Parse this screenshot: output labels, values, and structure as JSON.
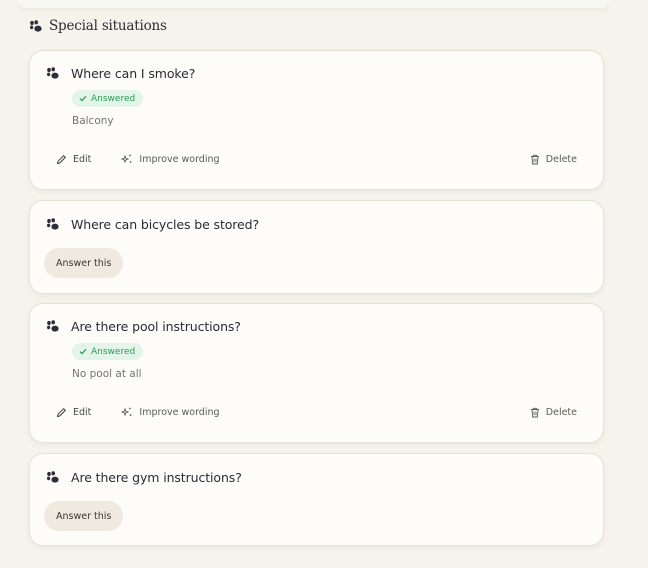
{
  "section": {
    "title": "Special situations"
  },
  "questions": [
    {
      "question": "Where can I smoke?",
      "status": "Answered",
      "answer": "Balcony"
    },
    {
      "question": "Where can bicycles be stored?",
      "cta": "Answer this"
    },
    {
      "question": "Are there pool instructions?",
      "status": "Answered",
      "answer": "No pool at all"
    },
    {
      "question": "Are there gym instructions?",
      "cta": "Answer this"
    }
  ],
  "actions": {
    "edit": "Edit",
    "improve": "Improve wording",
    "delete": "Delete"
  },
  "colors": {
    "background": "#f6f3ec",
    "card": "#fdfcf8",
    "answered_bg": "#e3f5e8",
    "answered_text": "#2f9a57",
    "cta_bg": "#efe9df"
  }
}
